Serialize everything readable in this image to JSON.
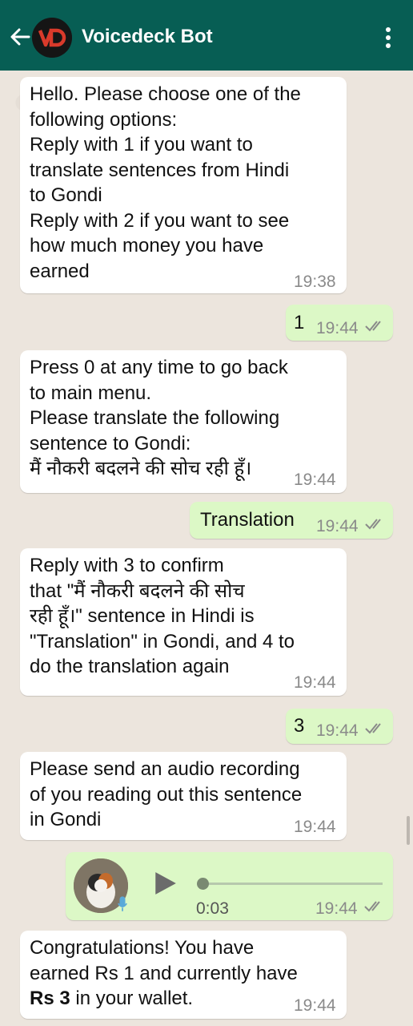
{
  "header": {
    "title": "Voicedeck Bot",
    "avatar_letters": "VD"
  },
  "messages": [
    {
      "dir": "in",
      "text": "Hello. Please choose one of the\nfollowing options:\nReply with 1 if you want to\ntranslate sentences from Hindi\nto Gondi\nReply with 2 if you want to see\nhow much money you have\nearned",
      "time": "19:38"
    },
    {
      "dir": "out",
      "text": "1",
      "time": "19:44",
      "read": true
    },
    {
      "dir": "in",
      "text": "Press 0 at any time to go back\nto main menu.\nPlease translate the following\nsentence to Gondi:\nमैं नौकरी बदलने की सोच रही हूँ।",
      "time": "19:44"
    },
    {
      "dir": "out",
      "text": "Translation",
      "time": "19:44",
      "read": true
    },
    {
      "dir": "in",
      "text": "Reply with 3 to confirm\nthat \"मैं नौकरी बदलने की सोच\nरही हूँ।\" sentence in Hindi is\n\"Translation\" in Gondi, and 4 to\ndo the translation again",
      "time": "19:44"
    },
    {
      "dir": "out",
      "text": "3",
      "time": "19:44",
      "read": true
    },
    {
      "dir": "in",
      "text": "Please send an audio recording\nof you reading out this sentence\nin Gondi",
      "time": "19:44"
    },
    {
      "dir": "out",
      "type": "voice",
      "duration": "0:03",
      "progress": 0.0,
      "time": "19:44",
      "read": true
    },
    {
      "dir": "in",
      "text_plain_1": "Congratulations! You have\nearned Rs 1 and currently have\n",
      "text_bold": "Rs 3",
      "text_plain_2": " in your wallet.",
      "time": "19:44"
    }
  ]
}
